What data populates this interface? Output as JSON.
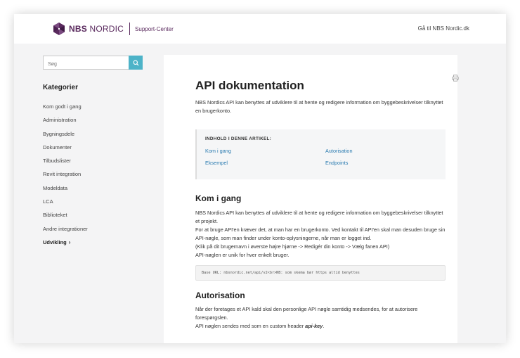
{
  "header": {
    "brand_bold": "NBS",
    "brand_rest": "NORDIC",
    "subtitle": "Support-Center",
    "right_link": "Gå til NBS Nordic.dk"
  },
  "sidebar": {
    "search_placeholder": "Søg",
    "categories_title": "Kategorier",
    "items": [
      {
        "label": "Kom godt i gang"
      },
      {
        "label": "Administration"
      },
      {
        "label": "Bygningsdele"
      },
      {
        "label": "Dokumenter"
      },
      {
        "label": "Tilbudslister"
      },
      {
        "label": "Revit integration"
      },
      {
        "label": "Modeldata"
      },
      {
        "label": "LCA"
      },
      {
        "label": "Biblioteket"
      },
      {
        "label": "Andre integrationer"
      },
      {
        "label": "Udvikling",
        "chevron": "›"
      }
    ]
  },
  "article": {
    "title": "API dokumentation",
    "intro": "NBS Nordics API kan benyttes af udviklere til at hente og redigere information om byggebeskrivelser tilknyttet en brugerkonto.",
    "toc": {
      "title": "INDHOLD I DENNE ARTIKEL:",
      "links": [
        "Kom i gang",
        "Autorisation",
        "Eksempel",
        "Endpoints"
      ]
    },
    "section1": {
      "heading": "Kom i gang",
      "lines": [
        "NBS Nordics API kan benyttes af udviklere til at hente og redigere information om byggebeskrivelser tilknyttet et projekt.",
        "For at bruge API'en kræver det, at man har en brugerkonto. Ved kontakt til API'en skal man desuden bruge sin API-nøgle, som man finder under konto-oplysningerne, når man er logget ind.",
        "(Klik på dit brugernavn i øverste højre hjørne -> Redigér din konto -> Vælg fanen API)",
        "API-nøglen er unik for hver enkelt bruger."
      ],
      "code": "Base URL: nbsnordic.net/api/v2<br>NB: som skema bør https altid benyttes"
    },
    "section2": {
      "heading": "Autorisation",
      "line1": "Når der foretages et API kald skal den personlige API nøgle samtidig medsendes, for at autorisere forespørgslen.",
      "line2_prefix": "API nøglen sendes med som en custom header ",
      "line2_header": "api-key",
      "line2_suffix": "."
    }
  }
}
